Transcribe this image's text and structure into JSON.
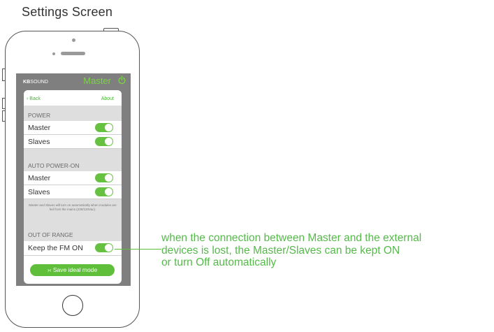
{
  "page_title": "Settings Screen",
  "header": {
    "brand_bold": "KB",
    "brand_rest": "SOUND",
    "title": "Master",
    "power_icon": "power-icon",
    "accent": "#7dd24a"
  },
  "nav": {
    "back_label": "Back",
    "about_label": "About"
  },
  "sections": {
    "power": {
      "title": "POWER",
      "rows": [
        {
          "label": "Master",
          "on": true
        },
        {
          "label": "Slaves",
          "on": true
        }
      ]
    },
    "auto_power": {
      "title": "AUTO POWER-ON",
      "rows": [
        {
          "label": "Master",
          "on": true
        },
        {
          "label": "Slaves",
          "on": true
        }
      ],
      "note": "Master and Slaves will turn on automatically when modules are fed from the mains (230/120Vac)."
    },
    "out_of_range": {
      "title": "OUT OF RANGE",
      "rows": [
        {
          "label": "Keep the FM ON",
          "on": true
        }
      ]
    }
  },
  "save_button": {
    "icon": "compress-arrows-icon",
    "icon_glyph": "›‹",
    "label": "Save ideal mode"
  },
  "annotation": {
    "lines": [
      "when the connection between Master and the external",
      "devices is lost, the Master/Slaves can be kept ON",
      "or turn Off automatically"
    ]
  },
  "colors": {
    "toggle_on": "#65c13f",
    "screen_bg": "#7f7f7f",
    "section_bg": "#dedede",
    "annotation": "#55b94a"
  }
}
